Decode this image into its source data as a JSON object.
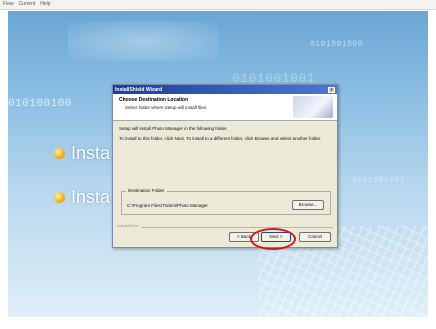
{
  "menu": [
    "Fiew",
    "Current",
    "Help"
  ],
  "background": {
    "binary_texts": [
      "0101001000",
      "010100100",
      "0101001001",
      "0101001001"
    ],
    "bullets": [
      "Insta",
      "Insta"
    ]
  },
  "dialog": {
    "title": "InstallShield Wizard",
    "close_label": "x",
    "header_title": "Choose Destination Location",
    "header_subtitle": "Select folder where Setup will install files.",
    "line1": "Setup will install Photo Manager in the following folder.",
    "line2": "To install to this folder, click Next. To install to a different folder, click Browse and select another folder.",
    "group_label": "Destination Folder",
    "destination_path": "C:\\Program Files\\Trident\\Photo Manager",
    "browse_label": "Browse...",
    "footer_label": "InstallShield",
    "back_label": "< Back",
    "next_label": "Next >",
    "cancel_label": "Cancel"
  },
  "colors": {
    "annotation": "#d01818",
    "titlebar": "#1c3f9b",
    "bullet": "#f5b21e"
  }
}
